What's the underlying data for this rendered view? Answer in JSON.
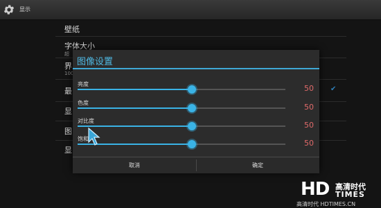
{
  "app": {
    "title": "显示"
  },
  "background_list": {
    "items": [
      "壁纸",
      "字体大小",
      "界",
      "最",
      "显",
      "图",
      "显"
    ],
    "subtexts": [
      "超",
      "100"
    ]
  },
  "dialog": {
    "title": "图像设置",
    "settings": [
      {
        "label": "亮度",
        "value": "50",
        "level": 0.55
      },
      {
        "label": "色度",
        "value": "50",
        "level": 0.55
      },
      {
        "label": "对比度",
        "value": "50",
        "level": 0.55
      },
      {
        "label": "饱和",
        "value": "50",
        "level": 0.55
      }
    ],
    "cancel_label": "取消",
    "ok_label": "确定"
  },
  "watermark": {
    "logo_text": "HD",
    "cn_text": "高清时代",
    "times_text": "TIMES",
    "url": "高清时代 HDTIMES.CN"
  },
  "colors": {
    "accent": "#3ab3e6",
    "value_text": "#e06a6a",
    "dialog_bg": "#2c2c2c",
    "page_bg": "#141414"
  }
}
